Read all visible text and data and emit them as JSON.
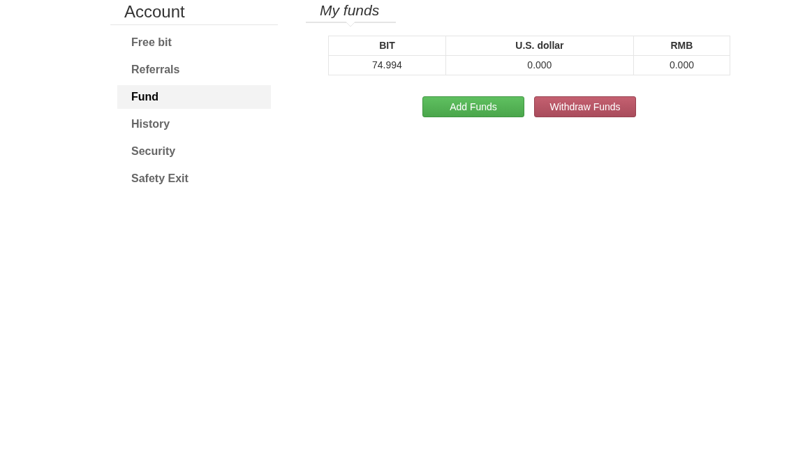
{
  "sidebar": {
    "title": "Account",
    "items": [
      {
        "label": "Free bit",
        "selected": false
      },
      {
        "label": "Referrals",
        "selected": false
      },
      {
        "label": "Fund",
        "selected": true
      },
      {
        "label": "History",
        "selected": false
      },
      {
        "label": "Security",
        "selected": false
      },
      {
        "label": "Safety Exit",
        "selected": false
      }
    ]
  },
  "section_title": "My funds",
  "table": {
    "columns": [
      "BIT",
      "U.S. dollar",
      "RMB"
    ],
    "rows": [
      [
        "74.994",
        "0.000",
        "0.000"
      ]
    ]
  },
  "buttons": [
    {
      "label": "Add Funds",
      "kind": "success"
    },
    {
      "label": "Withdraw Funds",
      "kind": "danger"
    }
  ]
}
